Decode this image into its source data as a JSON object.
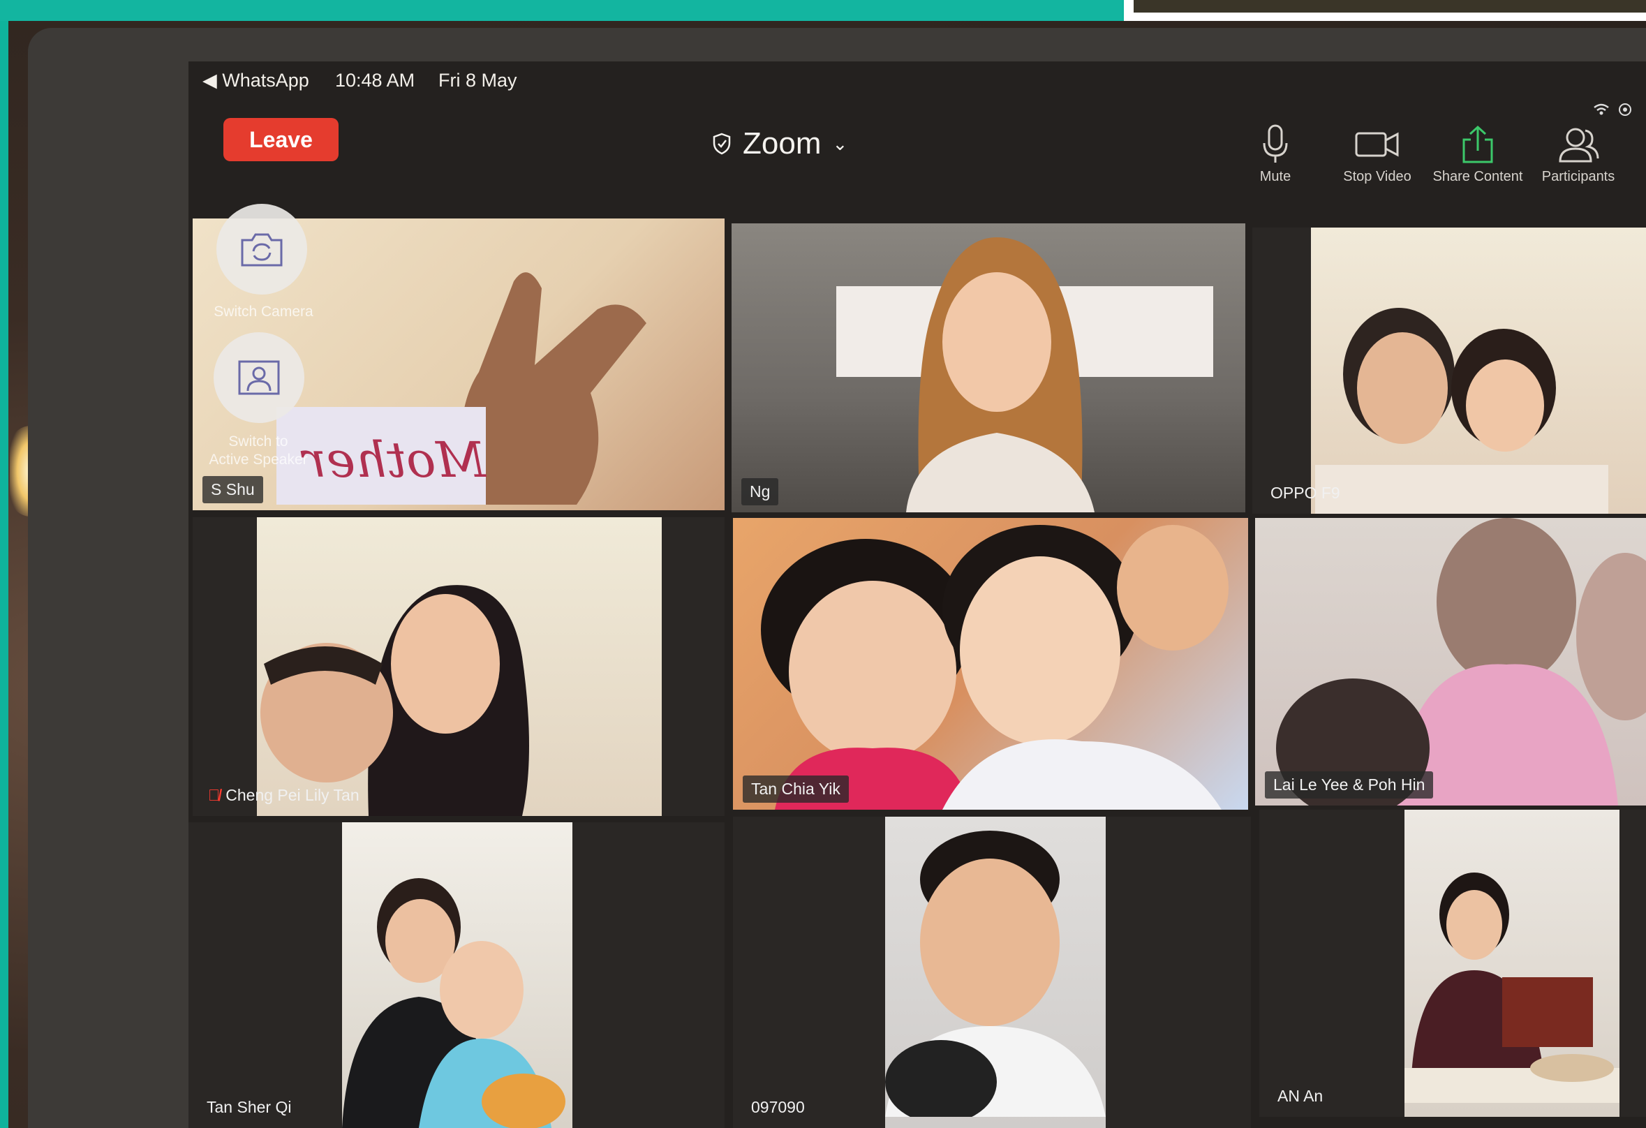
{
  "status_bar": {
    "back_app": "◀ WhatsApp",
    "time": "10:48 AM",
    "date": "Fri 8 May"
  },
  "toolbar": {
    "leave_label": "Leave",
    "meeting_title": "Zoom",
    "mute_label": "Mute",
    "stop_video_label": "Stop Video",
    "share_content_label": "Share Content",
    "participants_label": "Participants"
  },
  "overlay": {
    "switch_camera_label": "Switch Camera",
    "switch_speaker_label_1": "Switch to",
    "switch_speaker_label_2": "Active Speaker"
  },
  "participants": [
    {
      "name": "S Shu"
    },
    {
      "name": "Ng"
    },
    {
      "name": "OPPO F9"
    },
    {
      "name": "Cheng Pei Lily Tan",
      "muted": true
    },
    {
      "name": "Tan Chia Yik"
    },
    {
      "name": "Lai Le Yee & Poh Hin"
    },
    {
      "name": "Tan Sher Qi"
    },
    {
      "name": "097090"
    },
    {
      "name": "AN An"
    }
  ],
  "handwritten_sign_text": "Mother"
}
